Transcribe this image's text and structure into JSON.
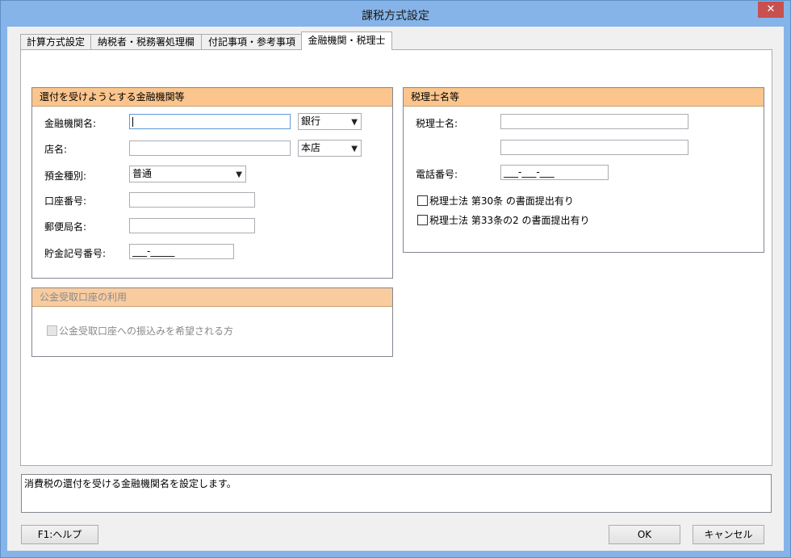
{
  "window": {
    "title": "課税方式設定",
    "close_glyph": "✕"
  },
  "tabs": [
    {
      "label": "計算方式設定",
      "active": false
    },
    {
      "label": "納税者・税務署処理欄",
      "active": false
    },
    {
      "label": "付記事項・参考事項",
      "active": false
    },
    {
      "label": "金融機関・税理士",
      "active": true
    }
  ],
  "refund_bank": {
    "header": "還付を受けようとする金融機関等",
    "bank_name_label": "金融機関名:",
    "bank_name_value": "",
    "bank_type_selected": "銀行",
    "branch_label": "店名:",
    "branch_value": "",
    "branch_type_selected": "本店",
    "deposit_type_label": "預金種別:",
    "deposit_type_selected": "普通",
    "account_number_label": "口座番号:",
    "account_number_value": "",
    "post_office_label": "郵便局名:",
    "post_office_value": "",
    "savings_number_label": "貯金記号番号:",
    "savings_number_mask": "___-_____"
  },
  "public_account": {
    "header": "公金受取口座の利用",
    "checkbox_label": "公金受取口座への振込みを希望される方",
    "checked": false
  },
  "tax_accountant": {
    "header": "税理士名等",
    "name_label": "税理士名:",
    "name_value": "",
    "name_value_2": "",
    "phone_label": "電話番号:",
    "phone_mask": "___-___-___",
    "art30_label": "税理士法 第30条 の書面提出有り",
    "art30_checked": false,
    "art33_label": "税理士法 第33条の2 の書面提出有り",
    "art33_checked": false
  },
  "status_text": "消費税の還付を受ける金融機関名を設定します。",
  "buttons": {
    "help": "F1:ヘルプ",
    "ok": "OK",
    "cancel": "キャンセル"
  }
}
